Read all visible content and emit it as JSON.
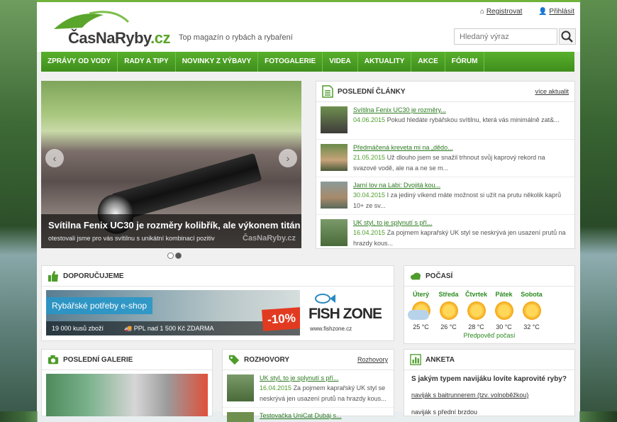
{
  "header": {
    "logo_name": "ČasNaRyby",
    "logo_tld": ".cz",
    "tagline": "Top magazín o rybách a rybaření",
    "register": "Registrovat",
    "login": "Přihlásit",
    "search_placeholder": "Hledaný výraz"
  },
  "nav": [
    "ZPRÁVY OD VODY",
    "RADY A TIPY",
    "NOVINKY Z VÝBAVY",
    "FOTOGALERIE",
    "VIDEA",
    "AKTUALITY",
    "AKCE",
    "FÓRUM"
  ],
  "slider": {
    "title": "Svítilna Fenix UC30 je rozměry kolibřík, ale výkonem titán",
    "subtitle": "otestovali jsme pro vás svítilnu s unikátní kombinací pozitiv",
    "watermark": "ČasNaRyby.cz",
    "slides": 2,
    "active": 2
  },
  "latest": {
    "title": "POSLEDNÍ ČLÁNKY",
    "more": "více aktualit",
    "items": [
      {
        "link": "Svítilna Fenix UC30 je rozměry...",
        "date": "04.06.2015",
        "text": "Pokud hledáte rybářskou svítilnu, která vás minimálně zat&..."
      },
      {
        "link": "Předmáčená kreveta mi na „dědo...",
        "date": "21.05.2015",
        "text": "Už dlouho jsem se snažil trhnout svůj kaprový rekord na svazové vodě, ale na a ne se m..."
      },
      {
        "link": "Jarní lov na Labi: Dvojitá kou...",
        "date": "30.04.2015",
        "text": "I za jediný víkend máte možnost si užít na prutu několik kaprů 10+ ze sv..."
      },
      {
        "link": "UK styl, to je splynutí s pří...",
        "date": "16.04.2015",
        "text": "Za pojmem kaprařský UK styl se neskrývá jen usazení prutů na hrazdy kous..."
      }
    ]
  },
  "recommend": {
    "title": "DOPORUČUJEME",
    "shop": "Rybářské potřeby e-shop",
    "items": "19 000 kusů zboží",
    "shipping": "PPL nad 1 500 Kč ZDARMA",
    "sale": "-10%",
    "brand": "FISH ZONE",
    "url": "www.fishzone.cz"
  },
  "weather": {
    "title": "POČASÍ",
    "days": [
      {
        "name": "Úterý",
        "temp": "25 °C",
        "cloudy": true
      },
      {
        "name": "Středa",
        "temp": "26 °C",
        "cloudy": false
      },
      {
        "name": "Čtvrtek",
        "temp": "28 °C",
        "cloudy": false
      },
      {
        "name": "Pátek",
        "temp": "30 °C",
        "cloudy": false
      },
      {
        "name": "Sobota",
        "temp": "32 °C",
        "cloudy": false
      }
    ],
    "forecast": "Předpověď počasí"
  },
  "gallery": {
    "title": "POSLEDNÍ GALERIE"
  },
  "interviews": {
    "title": "ROZHOVORY",
    "more": "Rozhovory",
    "item": {
      "link": "UK styl, to je splynutí s pří...",
      "date": "16.04.2015",
      "text": "Za pojmem kaprařský UK styl se neskrývá jen usazení prutů na hrazdy kous..."
    },
    "item2": "Testovačka UniCat Dubáj s..."
  },
  "poll": {
    "title": "ANKETA",
    "question": "S jakým typem navijáku lovíte kaprovité ryby?",
    "option1": "naviják s baitrunnerem (tzv. volnoběžkou)",
    "option2": "naviják s přední brzdou"
  }
}
